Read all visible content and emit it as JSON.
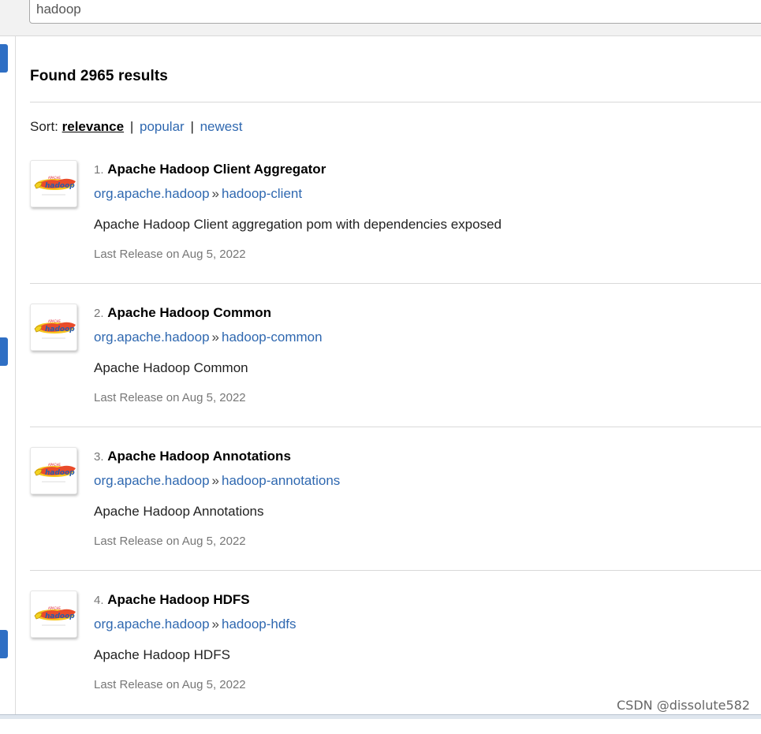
{
  "search": {
    "value": "hadoop"
  },
  "results_header": {
    "found_text": "Found 2965 results"
  },
  "sort": {
    "label": "Sort:",
    "options": [
      {
        "label": "relevance",
        "active": true
      },
      {
        "label": "popular",
        "active": false
      },
      {
        "label": "newest",
        "active": false
      }
    ],
    "separator": "|"
  },
  "results": [
    {
      "number": "1.",
      "title": "Apache Hadoop Client Aggregator",
      "group": "org.apache.hadoop",
      "artifact": "hadoop-client",
      "description": "Apache Hadoop Client aggregation pom with dependencies exposed",
      "release": "Last Release on Aug 5, 2022"
    },
    {
      "number": "2.",
      "title": "Apache Hadoop Common",
      "group": "org.apache.hadoop",
      "artifact": "hadoop-common",
      "description": "Apache Hadoop Common",
      "release": "Last Release on Aug 5, 2022"
    },
    {
      "number": "3.",
      "title": "Apache Hadoop Annotations",
      "group": "org.apache.hadoop",
      "artifact": "hadoop-annotations",
      "description": "Apache Hadoop Annotations",
      "release": "Last Release on Aug 5, 2022"
    },
    {
      "number": "4.",
      "title": "Apache Hadoop HDFS",
      "group": "org.apache.hadoop",
      "artifact": "hadoop-hdfs",
      "description": "Apache Hadoop HDFS",
      "release": "Last Release on Aug 5, 2022"
    }
  ],
  "coords_separator": "»",
  "icons": {
    "result_logo": "hadoop-logo-icon"
  },
  "colors": {
    "link": "#2f68b0",
    "accent_tab": "#2f6fc4"
  },
  "watermark": "CSDN @dissolute582"
}
